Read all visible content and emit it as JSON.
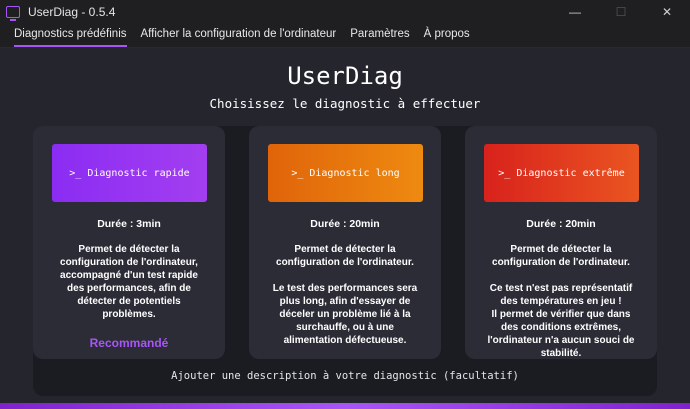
{
  "window": {
    "title": "UserDiag - 0.5.4",
    "controls": {
      "minimize": "—",
      "maximize": "☐",
      "close": "✕"
    }
  },
  "tabs": [
    {
      "label": "Diagnostics prédéfinis",
      "active": true
    },
    {
      "label": "Afficher la configuration de l'ordinateur",
      "active": false
    },
    {
      "label": "Paramètres",
      "active": false
    },
    {
      "label": "À propos",
      "active": false
    }
  ],
  "main": {
    "title": "UserDiag",
    "subtitle": "Choisissez le diagnostic à effectuer",
    "add_description": "Ajouter une description à votre diagnostic (facultatif)"
  },
  "cards": [
    {
      "button_label": ">_ Diagnostic rapide",
      "duration": "Durée : 3min",
      "description": "Permet de détecter la\nconfiguration de l'ordinateur,\naccompagné d'un test rapide\ndes performances, afin de\ndétecter de potentiels\nproblèmes.",
      "badge": "Recommandé"
    },
    {
      "button_label": ">_ Diagnostic long",
      "duration": "Durée : 20min",
      "description": "Permet de détecter la\nconfiguration de l'ordinateur.\n\nLe test des performances sera\nplus long, afin d'essayer de\ndéceler un problème lié à la\nsurchauffe, ou à une\nalimentation défectueuse."
    },
    {
      "button_label": ">_ Diagnostic extrême",
      "duration": "Durée : 20min",
      "description": "Permet de détecter la\nconfiguration de l'ordinateur.\n\nCe test n'est pas représentatif\ndes températures en jeu !\nIl permet de vérifier que dans\ndes conditions extrêmes,\nl'ordinateur n'a aucun souci de\nstabilité."
    }
  ],
  "colors": {
    "accent": "#a855f7",
    "rapide": "#8b2cf3",
    "long": "#e0640a",
    "extreme": "#d8221c"
  }
}
